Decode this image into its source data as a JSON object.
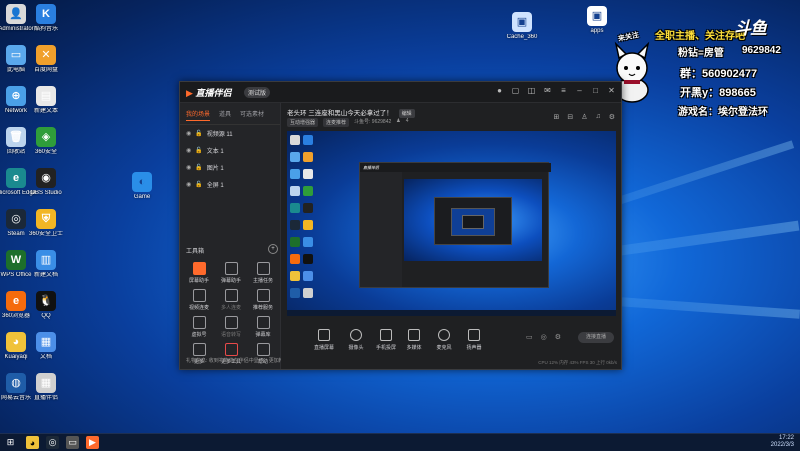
{
  "desktop": {
    "icons": [
      {
        "label": "Administrator",
        "color": "#d9d9d9",
        "glyph": "👤"
      },
      {
        "label": "酷狗音乐",
        "color": "#2a7fe0",
        "glyph": "K"
      },
      {
        "label": "此电脑",
        "color": "#5aa8ec",
        "glyph": "▭"
      },
      {
        "label": "百度网盘",
        "color": "#f0a02c",
        "glyph": "✕"
      },
      {
        "label": "Network",
        "color": "#4aa0e8",
        "glyph": "⊕"
      },
      {
        "label": "新建文本",
        "color": "#e8e8e8",
        "glyph": "▤"
      },
      {
        "label": "回收站",
        "color": "#bcd4ee",
        "glyph": "🗑"
      },
      {
        "label": "360安全",
        "color": "#2f9d3a",
        "glyph": "◈"
      },
      {
        "label": "Microsoft Edge",
        "color": "#1a8a8f",
        "glyph": "e"
      },
      {
        "label": "OBS Studio",
        "color": "#222222",
        "glyph": "◉"
      },
      {
        "label": "Steam",
        "color": "#1b2838",
        "glyph": "◎"
      },
      {
        "label": "360安全卫士",
        "color": "#f2b624",
        "glyph": "⛨"
      },
      {
        "label": "WPS Office",
        "color": "#1d6f2b",
        "glyph": "W"
      },
      {
        "label": "新建文档",
        "color": "#3a8ee6",
        "glyph": "▥"
      },
      {
        "label": "360浏览器",
        "color": "#f56b0c",
        "glyph": "e"
      },
      {
        "label": "QQ",
        "color": "#111111",
        "glyph": "🐧"
      },
      {
        "label": "Kuaiyaqi",
        "color": "#f0c23a",
        "glyph": "◕"
      },
      {
        "label": "文档",
        "color": "#4c8fe8",
        "glyph": "▦"
      },
      {
        "label": "网易云音乐",
        "color": "#1f5da8",
        "glyph": "◍"
      },
      {
        "label": "直播伴侣",
        "color": "#d0d0d0",
        "glyph": "▦"
      }
    ],
    "extra_icons": [
      {
        "label": "Game",
        "color": "#2a8ee8",
        "glyph": "◐"
      },
      {
        "label": "Cache_360",
        "color": "#cfe3ff",
        "glyph": "▣"
      },
      {
        "label": "apps",
        "color": "#ffffff",
        "glyph": "▣"
      }
    ]
  },
  "app": {
    "logo": "直播伴侣",
    "version": "测试版",
    "tabs": [
      "我的场景",
      "道具",
      "可选素材"
    ],
    "scenes": [
      "视频源 11",
      "文本 1",
      "图片 1",
      "全屏 1"
    ],
    "toolbox_title": "工具箱",
    "toolbox_add": "+",
    "tools": [
      "屏幕助手",
      "弹幕助手",
      "主播任务",
      "视频连麦",
      "多人连麦",
      "推荐服务",
      "虚拟号",
      "语音转写",
      "弹幕库",
      "更多",
      "更多工具",
      "帮助"
    ],
    "note": "礼物信息: 收到礼物将在伴侣中显示，更加精准",
    "stream_title": "老头环 三连座和黑山今天必拿过了！",
    "stream_tag": "编辑",
    "stream_sub": [
      "互动增强器",
      "连麦推荐"
    ],
    "room_id": "斗鱼号: 9629842",
    "viewers": "4",
    "bottom_buttons": [
      "直播屏幕",
      "摄像头",
      "手机投屏",
      "多媒体",
      "麦克风",
      "扬声器"
    ],
    "go_live": "连接直播",
    "status_right": "CPU 12%   内存 43%   FPS 30   上行 0kb/s",
    "nested_title": "直播伴侣"
  },
  "overlay": {
    "follow": "全职主播、关注存吧",
    "fans": "粉钻=房管",
    "group": "群：560902477",
    "kaihei": "开黑y：898665",
    "game": "游戏名：埃尔登法环",
    "logo": "斗鱼",
    "room": "9629842",
    "cat_badge": "来关注"
  },
  "taskbar": {
    "time": "17:22",
    "date": "2022/3/3"
  }
}
